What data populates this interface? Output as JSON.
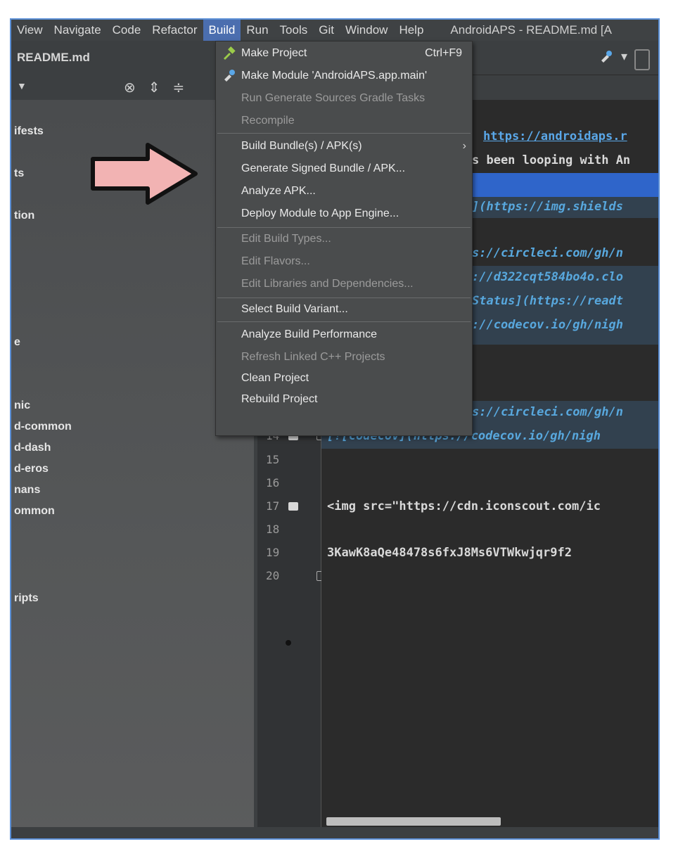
{
  "menubar": {
    "items": [
      "View",
      "Navigate",
      "Code",
      "Refactor",
      "Build",
      "Run",
      "Tools",
      "Git",
      "Window",
      "Help"
    ],
    "active": "Build",
    "window_title": "AndroidAPS - README.md [A"
  },
  "tab": {
    "label": "README.md"
  },
  "tree": {
    "items": [
      "ifests",
      "ts",
      "tion",
      "e",
      "nic",
      "d-common",
      "d-dash",
      "d-eros",
      "nans",
      "ommon",
      "ripts"
    ]
  },
  "build_menu": {
    "items": [
      {
        "label": "Make Project",
        "shortcut": "Ctrl+F9",
        "enabled": true,
        "icon": "hammer-icon"
      },
      {
        "label": "Make Module 'AndroidAPS.app.main'",
        "enabled": true,
        "icon": "build-module-icon"
      },
      {
        "label": "Run Generate Sources Gradle Tasks",
        "enabled": false
      },
      {
        "label": "Recompile",
        "enabled": false
      },
      {
        "label": "Build Bundle(s) / APK(s)",
        "enabled": true,
        "submenu": true
      },
      {
        "label": "Generate Signed Bundle / APK...",
        "enabled": true
      },
      {
        "label": "Analyze APK...",
        "enabled": true
      },
      {
        "label": "Deploy Module to App Engine...",
        "enabled": true
      },
      {
        "label": "Edit Build Types...",
        "enabled": false
      },
      {
        "label": "Edit Flavors...",
        "enabled": false
      },
      {
        "label": "Edit Libraries and Dependencies...",
        "enabled": false
      },
      {
        "label": "Select Build Variant...",
        "enabled": true
      },
      {
        "label": "Analyze Build Performance",
        "enabled": true
      },
      {
        "label": "Refresh Linked C++ Projects",
        "enabled": false
      },
      {
        "label": "Clean Project",
        "enabled": true
      },
      {
        "label": "Rebuild Project",
        "enabled": true
      }
    ]
  },
  "editor": {
    "visible_fragments": [
      "https://androidaps.r",
      "s been looping with An",
      "](https://img.shields",
      "s://circleci.com/gh/n",
      "://d322cqt584bo4o.clo",
      "Status](https://readt",
      "://codecov.io/gh/nigh",
      "s://circleci.com/gh/n",
      "[![codecov](https://codecov.io/gh/nigh",
      "<img src=\"https://cdn.iconscout.com/ic",
      "3KawK8aQe48478s6fxJ8Ms6VTWkwjqr9f2"
    ],
    "line_numbers": [
      "14",
      "15",
      "16",
      "17",
      "18",
      "19",
      "20"
    ]
  },
  "colors": {
    "menu_bg": "#4a4c4d",
    "active_menu": "#4b6eaf",
    "editor_bg": "#2b2b2b",
    "selection": "#2f65ca",
    "link": "#5aa7e8",
    "arrow_fill": "#f2b3b3",
    "frame_border": "#5b8fd6"
  }
}
